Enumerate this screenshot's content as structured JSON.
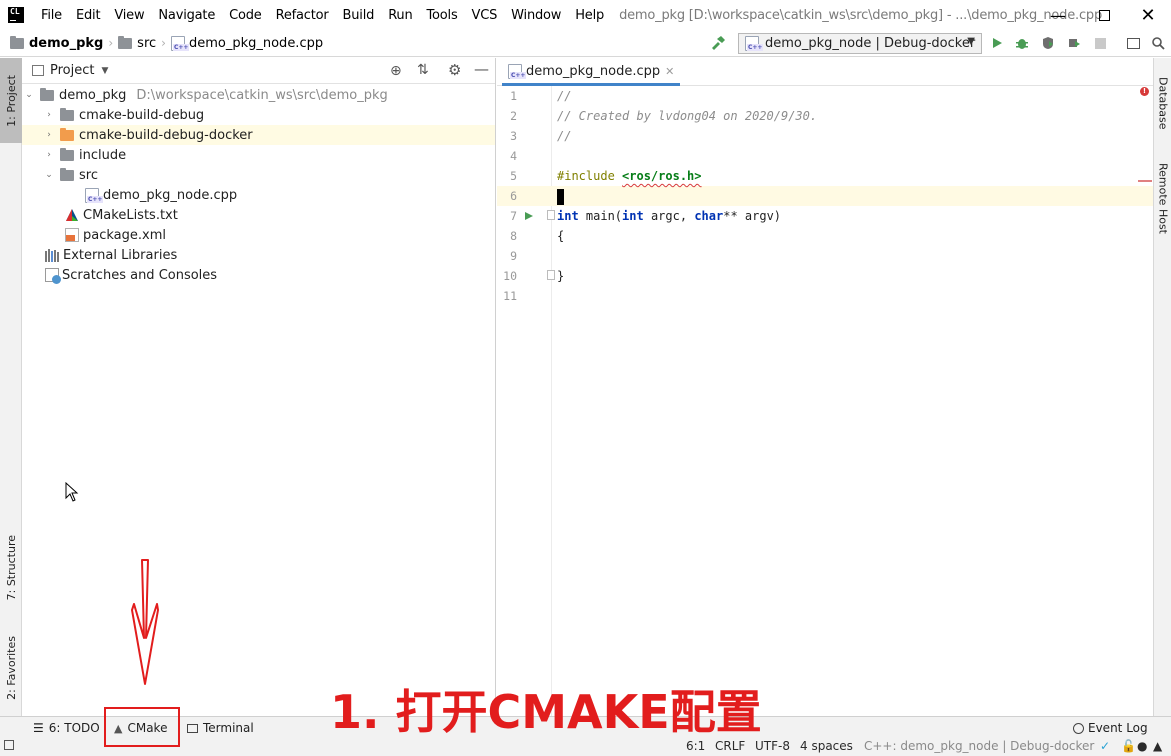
{
  "app": {
    "logo_text": "CL",
    "window_title": "demo_pkg [D:\\workspace\\catkin_ws\\src\\demo_pkg] - ...\\demo_pkg_node.cpp"
  },
  "menu": [
    "File",
    "Edit",
    "View",
    "Navigate",
    "Code",
    "Refactor",
    "Build",
    "Run",
    "Tools",
    "VCS",
    "Window",
    "Help"
  ],
  "breadcrumb": {
    "project": "demo_pkg",
    "folder": "src",
    "file": "demo_pkg_node.cpp"
  },
  "toolbar": {
    "run_config": "demo_pkg_node | Debug-docker"
  },
  "left_strip": {
    "project_tab": "1: Project",
    "structure_tab": "7: Structure",
    "favorites_tab": "2: Favorites"
  },
  "right_strip": {
    "database_tab": "Database",
    "remote_host_tab": "Remote Host"
  },
  "project_panel": {
    "title": "Project",
    "tree": [
      {
        "label": "demo_pkg",
        "path": "D:\\workspace\\catkin_ws\\src\\demo_pkg",
        "icon": "folder-icon",
        "expanded": true
      },
      {
        "label": "cmake-build-debug",
        "icon": "folder-icon",
        "expanded": false
      },
      {
        "label": "cmake-build-debug-docker",
        "icon": "folder-orange-icon",
        "expanded": false,
        "selected": true
      },
      {
        "label": "include",
        "icon": "folder-icon",
        "expanded": false
      },
      {
        "label": "src",
        "icon": "folder-icon",
        "expanded": true
      },
      {
        "label": "demo_pkg_node.cpp",
        "icon": "cpp-file-icon"
      },
      {
        "label": "CMakeLists.txt",
        "icon": "cmake-icon"
      },
      {
        "label": "package.xml",
        "icon": "xml-icon"
      },
      {
        "label": "External Libraries",
        "icon": "library-icon"
      },
      {
        "label": "Scratches and Consoles",
        "icon": "scratches-icon"
      }
    ]
  },
  "editor": {
    "tab_label": "demo_pkg_node.cpp",
    "line_numbers": [
      "1",
      "2",
      "3",
      "4",
      "5",
      "6",
      "7",
      "8",
      "9",
      "10",
      "11"
    ],
    "lines": {
      "l1": "//",
      "l2": "// Created by lvdong04 on 2020/9/30.",
      "l3": "//",
      "l5_directive": "#include ",
      "l5_header": "<ros/ros.h>",
      "l7_kw1": "int",
      "l7_mid1": " main(",
      "l7_kw2": "int",
      "l7_mid2": " argc, ",
      "l7_kw3": "char",
      "l7_rest": "** argv)",
      "l8": "{",
      "l10": "}"
    }
  },
  "bottom_tabs": {
    "todo": "6: TODO",
    "cmake": "CMake",
    "terminal": "Terminal",
    "event_log": "Event Log"
  },
  "status": {
    "position": "6:1",
    "line_ending": "CRLF",
    "encoding": "UTF-8",
    "indent": "4 spaces",
    "context": "C++: demo_pkg_node | Debug-docker"
  },
  "annotation": {
    "text": "1. 打开CMAKE配置",
    "color": "#e21d1d"
  },
  "colors": {
    "accent": "#4083c9",
    "run_green": "#499c54",
    "annotation_red": "#e21d1d",
    "selection_yellow": "#fffbe3"
  }
}
